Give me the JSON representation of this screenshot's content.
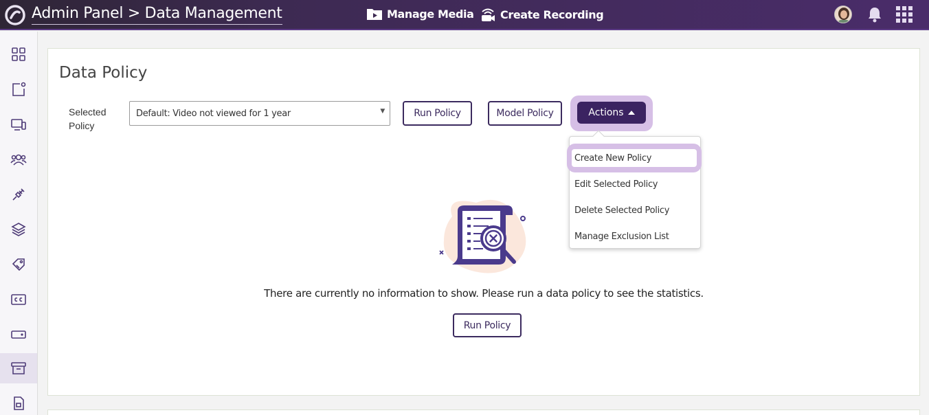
{
  "header": {
    "breadcrumb": "Admin Panel > Data Management",
    "nav": [
      {
        "label": "Manage Media",
        "icon": "media-folder-icon"
      },
      {
        "label": "Create Recording",
        "icon": "recording-icon"
      }
    ]
  },
  "sidebar": {
    "items": [
      {
        "icon": "dashboard-grid-icon"
      },
      {
        "icon": "content-icon"
      },
      {
        "icon": "devices-icon"
      },
      {
        "icon": "users-icon"
      },
      {
        "icon": "integrations-plug-icon"
      },
      {
        "icon": "layers-icon"
      },
      {
        "icon": "tag-icon"
      },
      {
        "icon": "closed-captions-icon"
      },
      {
        "icon": "storage-icon"
      },
      {
        "icon": "archive-icon",
        "active": true
      },
      {
        "icon": "reports-icon"
      }
    ]
  },
  "main": {
    "title": "Data Policy",
    "selected_policy_label": "Selected Policy",
    "selected_policy_value": "Default: Video not viewed for 1 year",
    "run_policy_label": "Run Policy",
    "model_policy_label": "Model Policy",
    "actions_label": "Actions",
    "actions_menu": [
      "Create New Policy",
      "Edit Selected Policy",
      "Delete Selected Policy",
      "Manage Exclusion List"
    ],
    "empty_message": "There are currently no information to show. Please run a data policy to see the statistics.",
    "empty_run_policy_label": "Run Policy"
  },
  "colors": {
    "accent": "#3b2361",
    "highlight": "#d6bfe6",
    "header_bg": "#3d2a52"
  }
}
